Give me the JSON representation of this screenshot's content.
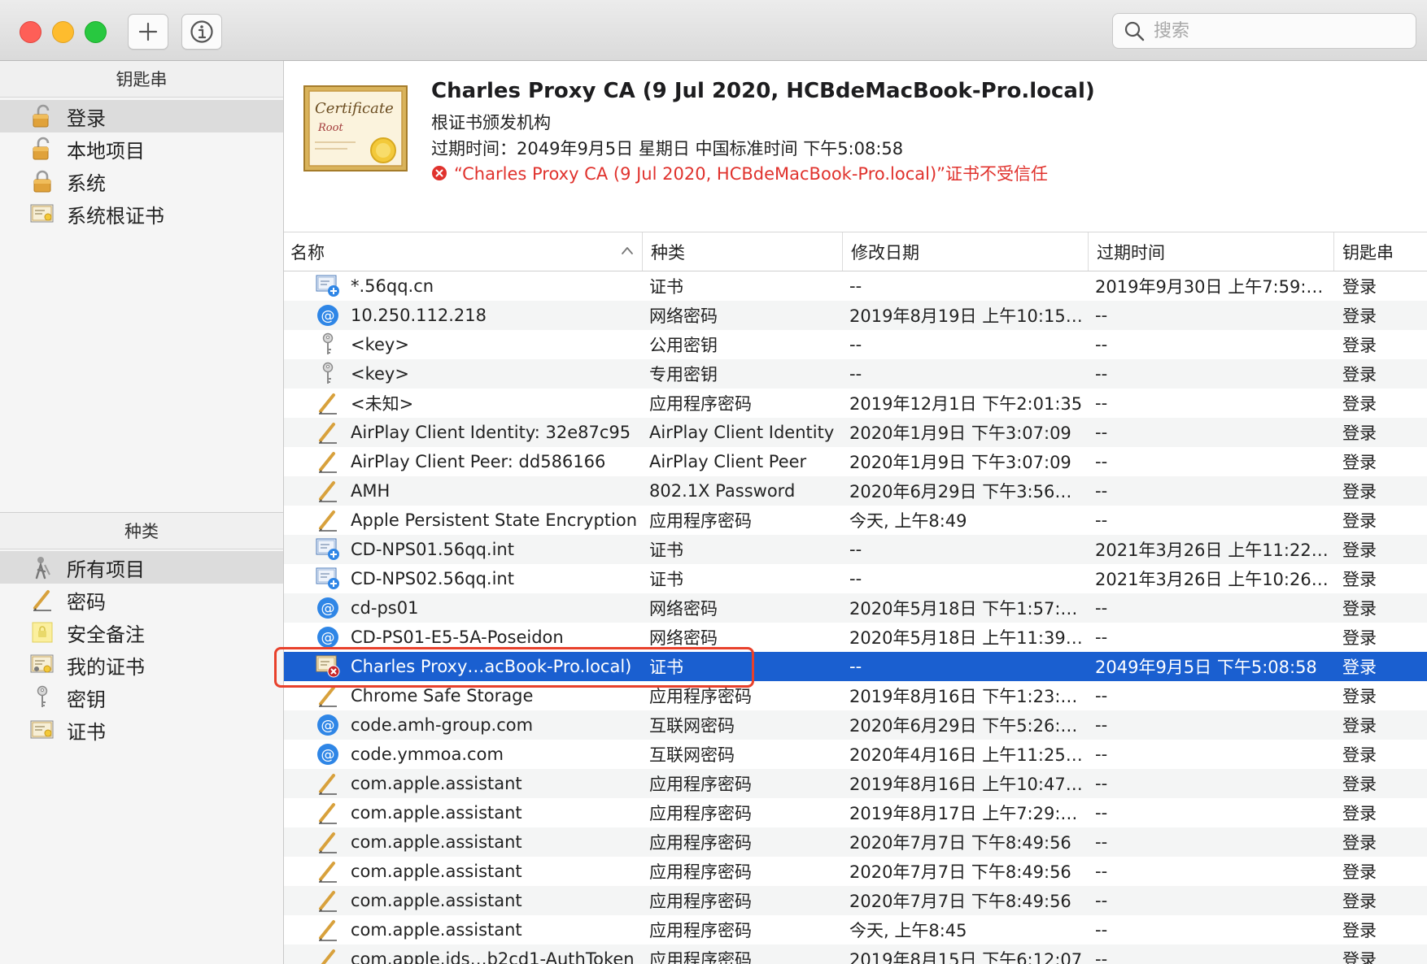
{
  "toolbar": {
    "search_placeholder": "搜索"
  },
  "sidebar": {
    "keychains_header": "钥匙串",
    "keychains": [
      {
        "label": "登录",
        "icon": "lock-open-icon",
        "selected": true
      },
      {
        "label": "本地项目",
        "icon": "lock-open-icon",
        "selected": false
      },
      {
        "label": "系统",
        "icon": "lock-icon",
        "selected": false
      },
      {
        "label": "系统根证书",
        "icon": "certificate-icon",
        "selected": false
      }
    ],
    "categories_header": "种类",
    "categories": [
      {
        "label": "所有项目",
        "icon": "all-items-icon",
        "selected": true
      },
      {
        "label": "密码",
        "icon": "pencil-icon",
        "selected": false
      },
      {
        "label": "安全备注",
        "icon": "secure-note-icon",
        "selected": false
      },
      {
        "label": "我的证书",
        "icon": "my-certificate-icon",
        "selected": false
      },
      {
        "label": "密钥",
        "icon": "key-icon",
        "selected": false
      },
      {
        "label": "证书",
        "icon": "certificate-icon",
        "selected": false
      }
    ]
  },
  "cert": {
    "image_text_line1": "Certificate",
    "image_text_line2": "Root",
    "title": "Charles Proxy CA (9 Jul 2020, HCBdeMacBook-Pro.local)",
    "subtitle": "根证书颁发机构",
    "expires": "过期时间：2049年9月5日 星期日 中国标准时间 下午5:08:58",
    "warning": "“Charles Proxy CA (9 Jul 2020, HCBdeMacBook-Pro.local)”证书不受信任",
    "warning_color": "#e0322d"
  },
  "table": {
    "headers": {
      "name": "名称",
      "kind": "种类",
      "date": "修改日期",
      "expires": "过期时间",
      "keychain": "钥匙串"
    },
    "rows": [
      {
        "icon": "certificate-plus-icon",
        "name": "*.56qq.cn",
        "kind": "证书",
        "date": "--",
        "expires": "2019年9月30日 上午7:59:…",
        "keychain": "登录"
      },
      {
        "icon": "at-icon",
        "name": "10.250.112.218",
        "kind": "网络密码",
        "date": "2019年8月19日 上午10:15…",
        "expires": "--",
        "keychain": "登录"
      },
      {
        "icon": "key-icon",
        "name": "<key>",
        "kind": "公用密钥",
        "date": "--",
        "expires": "--",
        "keychain": "登录"
      },
      {
        "icon": "key-icon",
        "name": "<key>",
        "kind": "专用密钥",
        "date": "--",
        "expires": "--",
        "keychain": "登录"
      },
      {
        "icon": "pencil-icon",
        "name": "<未知>",
        "kind": "应用程序密码",
        "date": "2019年12月1日 下午2:01:35",
        "expires": "--",
        "keychain": "登录"
      },
      {
        "icon": "pencil-icon",
        "name": "AirPlay Client Identity: 32e87c95",
        "kind": "AirPlay Client Identity",
        "date": "2020年1月9日 下午3:07:09",
        "expires": "--",
        "keychain": "登录"
      },
      {
        "icon": "pencil-icon",
        "name": "AirPlay Client Peer: dd586166",
        "kind": "AirPlay Client Peer",
        "date": "2020年1月9日 下午3:07:09",
        "expires": "--",
        "keychain": "登录"
      },
      {
        "icon": "pencil-icon",
        "name": "AMH",
        "kind": "802.1X Password",
        "date": "2020年6月29日 下午3:56…",
        "expires": "--",
        "keychain": "登录"
      },
      {
        "icon": "pencil-icon",
        "name": "Apple Persistent State Encryption",
        "kind": "应用程序密码",
        "date": "今天, 上午8:49",
        "expires": "--",
        "keychain": "登录"
      },
      {
        "icon": "certificate-plus-icon",
        "name": "CD-NPS01.56qq.int",
        "kind": "证书",
        "date": "--",
        "expires": "2021年3月26日 上午11:22…",
        "keychain": "登录"
      },
      {
        "icon": "certificate-plus-icon",
        "name": "CD-NPS02.56qq.int",
        "kind": "证书",
        "date": "--",
        "expires": "2021年3月26日 上午10:26…",
        "keychain": "登录"
      },
      {
        "icon": "at-icon",
        "name": "cd-ps01",
        "kind": "网络密码",
        "date": "2020年5月18日 下午1:57:…",
        "expires": "--",
        "keychain": "登录"
      },
      {
        "icon": "at-icon",
        "name": "CD-PS01-E5-5A-Poseidon",
        "kind": "网络密码",
        "date": "2020年5月18日 上午11:39…",
        "expires": "--",
        "keychain": "登录"
      },
      {
        "icon": "certificate-untrusted-icon",
        "name": "Charles Proxy…acBook-Pro.local)",
        "kind": "证书",
        "date": "--",
        "expires": "2049年9月5日 下午5:08:58",
        "keychain": "登录",
        "selected": true
      },
      {
        "icon": "pencil-icon",
        "name": "Chrome Safe Storage",
        "kind": "应用程序密码",
        "date": "2019年8月16日 下午1:23:…",
        "expires": "--",
        "keychain": "登录"
      },
      {
        "icon": "at-icon",
        "name": "code.amh-group.com",
        "kind": "互联网密码",
        "date": "2020年6月29日 下午5:26:…",
        "expires": "--",
        "keychain": "登录"
      },
      {
        "icon": "at-icon",
        "name": "code.ymmoa.com",
        "kind": "互联网密码",
        "date": "2020年4月16日 上午11:25…",
        "expires": "--",
        "keychain": "登录"
      },
      {
        "icon": "pencil-icon",
        "name": "com.apple.assistant",
        "kind": "应用程序密码",
        "date": "2019年8月16日 上午10:47…",
        "expires": "--",
        "keychain": "登录"
      },
      {
        "icon": "pencil-icon",
        "name": "com.apple.assistant",
        "kind": "应用程序密码",
        "date": "2019年8月17日 上午7:29:…",
        "expires": "--",
        "keychain": "登录"
      },
      {
        "icon": "pencil-icon",
        "name": "com.apple.assistant",
        "kind": "应用程序密码",
        "date": "2020年7月7日 下午8:49:56",
        "expires": "--",
        "keychain": "登录"
      },
      {
        "icon": "pencil-icon",
        "name": "com.apple.assistant",
        "kind": "应用程序密码",
        "date": "2020年7月7日 下午8:49:56",
        "expires": "--",
        "keychain": "登录"
      },
      {
        "icon": "pencil-icon",
        "name": "com.apple.assistant",
        "kind": "应用程序密码",
        "date": "2020年7月7日 下午8:49:56",
        "expires": "--",
        "keychain": "登录"
      },
      {
        "icon": "pencil-icon",
        "name": "com.apple.assistant",
        "kind": "应用程序密码",
        "date": "今天, 上午8:45",
        "expires": "--",
        "keychain": "登录"
      },
      {
        "icon": "pencil-icon",
        "name": "com.apple.ids…b2cd1-AuthToken",
        "kind": "应用程序密码",
        "date": "2019年8月15日 下午6:12:07",
        "expires": "--",
        "keychain": "登录"
      }
    ]
  },
  "colors": {
    "selection_blue": "#1a5fd0",
    "highlight_outline": "#e8412c"
  }
}
